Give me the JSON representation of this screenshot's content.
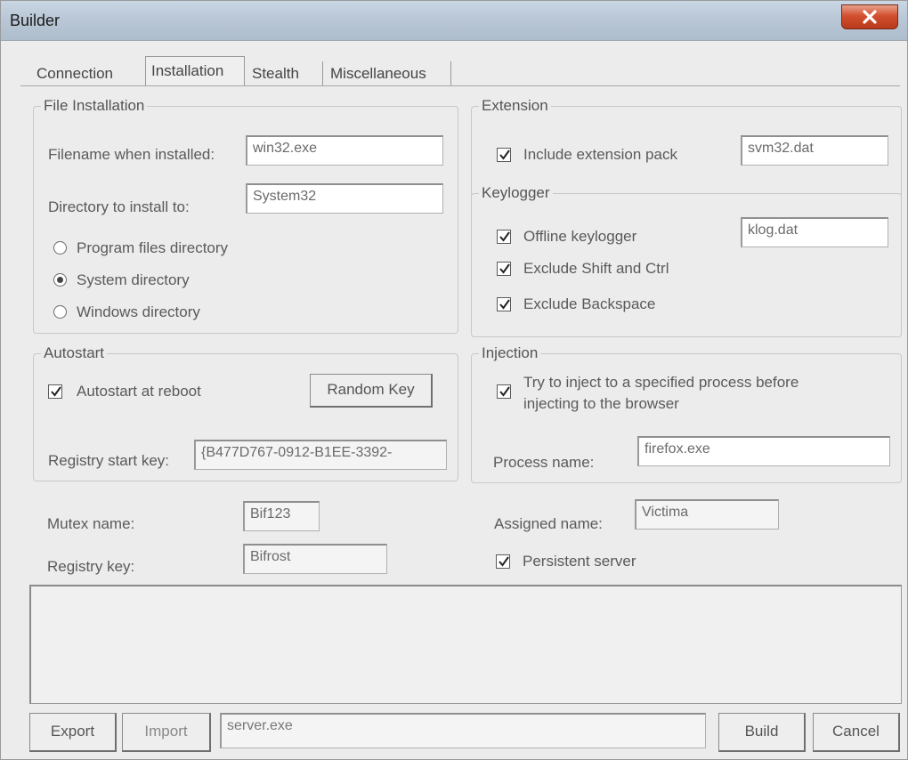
{
  "window": {
    "title": "Builder"
  },
  "tabs": [
    {
      "label": "Connection",
      "active": false
    },
    {
      "label": "Installation",
      "active": true
    },
    {
      "label": "Stealth",
      "active": false
    },
    {
      "label": "Miscellaneous",
      "active": false
    }
  ],
  "file_installation": {
    "legend": "File Installation",
    "filename_label": "Filename when installed:",
    "filename_value": "win32.exe",
    "directory_label": "Directory to install to:",
    "directory_value": "System32",
    "options": [
      {
        "label": "Program files directory",
        "selected": false
      },
      {
        "label": "System directory",
        "selected": true
      },
      {
        "label": "Windows directory",
        "selected": false
      }
    ]
  },
  "extension": {
    "legend": "Extension",
    "include_label": "Include extension pack",
    "include_checked": true,
    "file_value": "svm32.dat"
  },
  "keylogger": {
    "legend": "Keylogger",
    "offline_label": "Offline keylogger",
    "offline_checked": true,
    "file_value": "klog.dat",
    "exclude_shift_label": "Exclude Shift and Ctrl",
    "exclude_shift_checked": true,
    "exclude_backspace_label": "Exclude Backspace",
    "exclude_backspace_checked": true
  },
  "autostart": {
    "legend": "Autostart",
    "reboot_label": "Autostart at reboot",
    "reboot_checked": true,
    "random_key_label": "Random Key",
    "registry_label": "Registry start key:",
    "registry_value": "{B477D767-0912-B1EE-3392-"
  },
  "injection": {
    "legend": "Injection",
    "try_inject_line1": "Try to inject to a specified process before",
    "try_inject_line2": "injecting to the browser",
    "try_inject_checked": true,
    "process_label": "Process name:",
    "process_value": "firefox.exe"
  },
  "misc": {
    "mutex_label": "Mutex name:",
    "mutex_value": "Bif123",
    "registry_key_label": "Registry key:",
    "registry_key_value": "Bifrost",
    "assigned_label": "Assigned name:",
    "assigned_value": "Victima",
    "persistent_label": "Persistent server",
    "persistent_checked": true
  },
  "footer": {
    "export_label": "Export",
    "import_label": "Import",
    "output_file": "server.exe",
    "build_label": "Build",
    "cancel_label": "Cancel"
  },
  "icons": {
    "close": "close-icon",
    "check": "checkmark-icon"
  }
}
